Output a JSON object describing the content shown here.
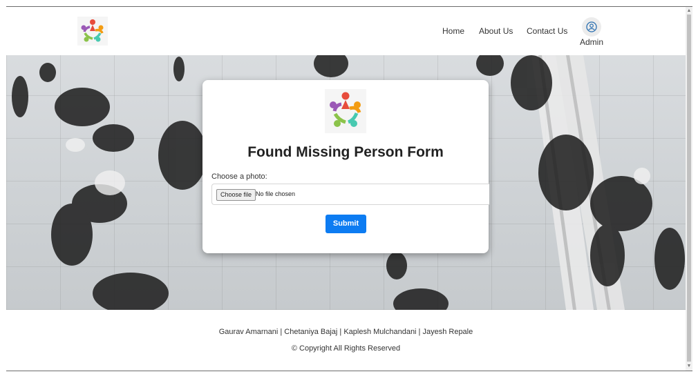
{
  "nav": {
    "home": "Home",
    "about": "About Us",
    "contact": "Contact Us",
    "admin": "Admin"
  },
  "form": {
    "title": "Found Missing Person Form",
    "photo_label": "Choose a photo:",
    "file_button": "Choose file",
    "file_status": "No file chosen",
    "submit": "Submit"
  },
  "footer": {
    "authors": "Gaurav Amarnani | Chetaniya Bajaj | Kaplesh Mulchandani | Jayesh Repale",
    "copyright": "© Copyright All Rights Reserved"
  },
  "icons": {
    "logo": "people-circle-logo",
    "admin": "user-circle-icon"
  },
  "colors": {
    "primary": "#0d7cf2"
  }
}
